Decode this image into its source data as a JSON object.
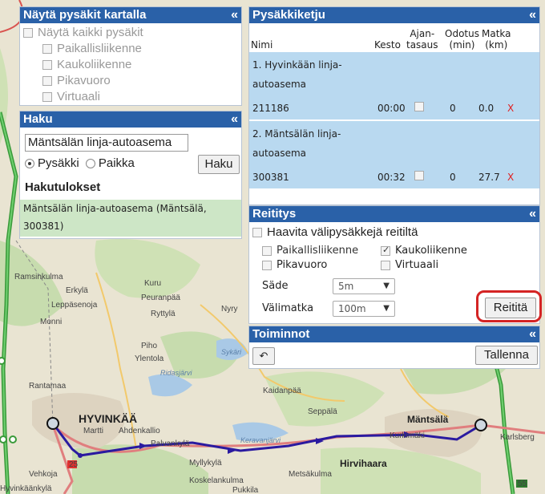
{
  "map": {
    "places": [
      "HYVINKÄÄ",
      "Mäntsälä",
      "Hirvihaara",
      "Seppälä",
      "Kaidanpää",
      "Martti",
      "Ahdenkallio",
      "Palvankylä",
      "Myllykylä",
      "Koskelankulma",
      "Vehkoja",
      "Metsäkulma",
      "Karlsberg",
      "Ramsinkulma",
      "Erkylä",
      "Leppäsenoja",
      "Monni",
      "Kuru",
      "Peuranpää",
      "Ryttylä",
      "Nyry",
      "Piho",
      "Ylentola",
      "Rantamaa",
      "Hyvinkäänkylä",
      "Kurkimäki",
      "Pukkila"
    ],
    "lakes": [
      "Ridasjärvi",
      "Sykäri",
      "Keravanjärvi"
    ],
    "road_numbers": [
      "25",
      "25",
      "55"
    ],
    "route_color": "#2a1aa0"
  },
  "nayta": {
    "title": "Näytä pysäkit kartalla",
    "collapse": "«",
    "show_all": "Näytä kaikki pysäkit",
    "options": [
      "Paikallisliikenne",
      "Kaukoliikenne",
      "Pikavuoro",
      "Virtuaali"
    ]
  },
  "haku": {
    "title": "Haku",
    "collapse": "«",
    "input_value": "Mäntsälän linja-autoasema",
    "radio_stop": "Pysäkki",
    "radio_place": "Paikka",
    "search_button": "Haku",
    "results_title": "Hakutulokset",
    "result_line1": "Mäntsälän linja-autoasema (Mäntsälä,",
    "result_line2": "300381)"
  },
  "ketju": {
    "title": "Pysäkkiketju",
    "collapse": "«",
    "col_nimi": "Nimi",
    "col_kesto": "Kesto",
    "col_ajantasaus1": "Ajan-",
    "col_ajantasaus2": "tasaus",
    "col_odotus1": "Odotus",
    "col_odotus2": "(min)",
    "col_matka1": "Matka",
    "col_matka2": "(km)",
    "stops": [
      {
        "name1": "1. Hyvinkään linja-",
        "name2": "autoasema",
        "code": "211186",
        "kesto": "00:00",
        "odotus": "0",
        "matka": "0.0",
        "remove": "X"
      },
      {
        "name1": "2. Mäntsälän linja-",
        "name2": "autoasema",
        "code": "300381",
        "kesto": "00:32",
        "odotus": "0",
        "matka": "27.7",
        "remove": "X"
      }
    ]
  },
  "reititys": {
    "title": "Reititys",
    "collapse": "«",
    "haavita": "Haavita välipysäkkejä reitiltä",
    "opt_paikallis": "Paikallisliikenne",
    "opt_kauko": "Kaukoliikenne",
    "opt_pika": "Pikavuoro",
    "opt_virtuaali": "Virtuaali",
    "sade_label": "Säde",
    "sade_value": "5m",
    "valimatka_label": "Välimatka",
    "valimatka_value": "100m",
    "route_button": "Reititä",
    "highlight_color": "#d42424"
  },
  "toiminnot": {
    "title": "Toiminnot",
    "collapse": "«",
    "undo_icon": "undo-icon",
    "save_button": "Tallenna"
  }
}
